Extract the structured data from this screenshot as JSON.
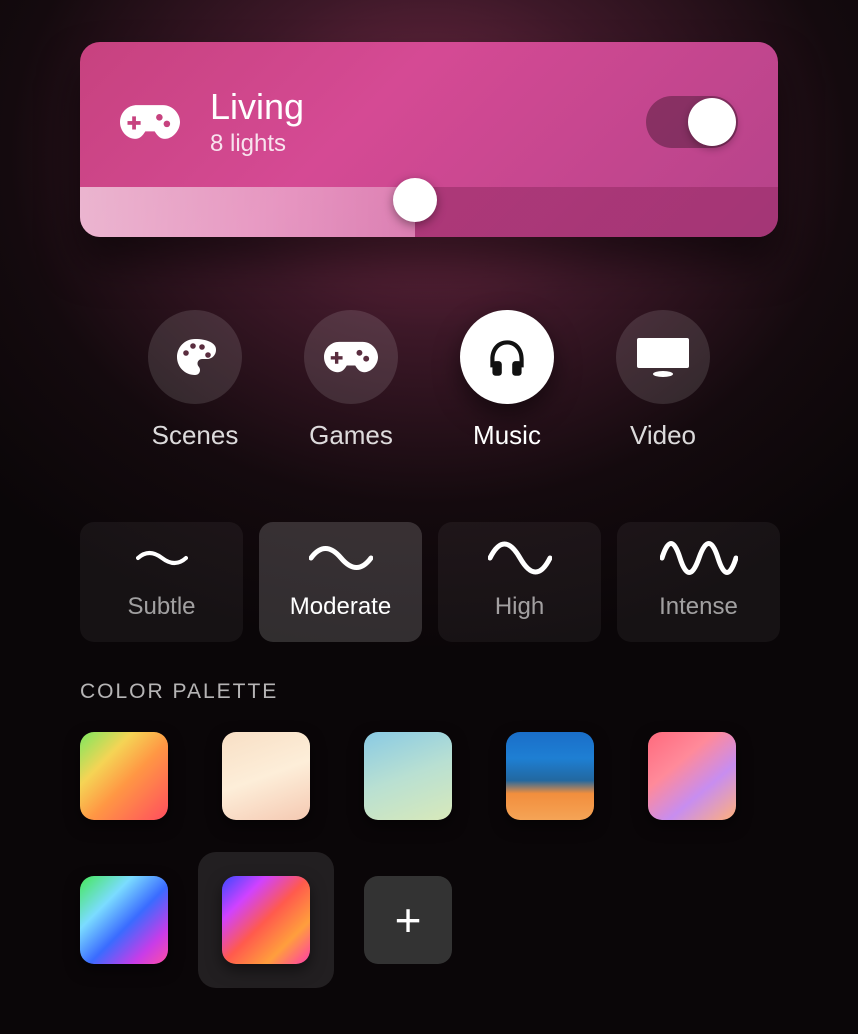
{
  "room": {
    "icon": "gamepad-icon",
    "title": "Living",
    "subtitle": "8 lights",
    "toggle_on": true,
    "brightness_percent": 48
  },
  "modes": [
    {
      "id": "scenes",
      "label": "Scenes",
      "icon": "palette-icon",
      "active": false
    },
    {
      "id": "games",
      "label": "Games",
      "icon": "gamepad-icon",
      "active": false
    },
    {
      "id": "music",
      "label": "Music",
      "icon": "headphones-icon",
      "active": true
    },
    {
      "id": "video",
      "label": "Video",
      "icon": "monitor-icon",
      "active": false
    }
  ],
  "intensity": {
    "options": [
      {
        "id": "subtle",
        "label": "Subtle",
        "active": false
      },
      {
        "id": "moderate",
        "label": "Moderate",
        "active": true
      },
      {
        "id": "high",
        "label": "High",
        "active": false
      },
      {
        "id": "intense",
        "label": "Intense",
        "active": false
      }
    ]
  },
  "palette": {
    "header": "COLOR PALETTE",
    "swatches": [
      {
        "id": "p1",
        "active": false
      },
      {
        "id": "p2",
        "active": false
      },
      {
        "id": "p3",
        "active": false
      },
      {
        "id": "p4",
        "active": false
      },
      {
        "id": "p5",
        "active": false
      },
      {
        "id": "p6",
        "active": false
      },
      {
        "id": "p7",
        "active": true
      }
    ],
    "add_label": "+"
  }
}
